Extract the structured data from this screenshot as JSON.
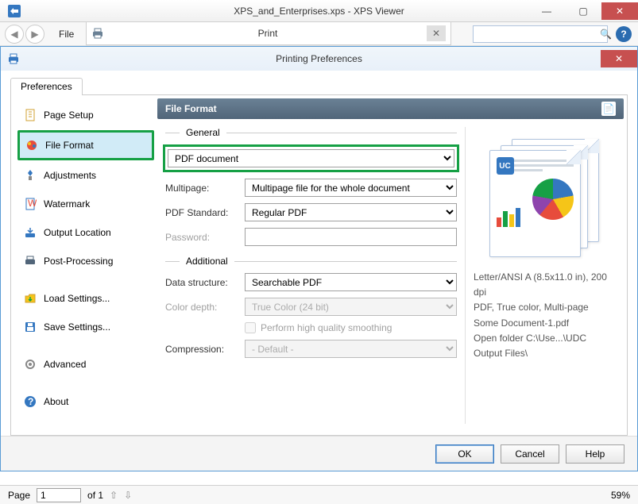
{
  "window": {
    "title": "XPS_and_Enterprises.xps - XPS Viewer",
    "min": "—",
    "max": "▢",
    "close": "✕"
  },
  "toolbar2": {
    "file": "File",
    "print_title": "Print",
    "close_x": "✕",
    "help": "?"
  },
  "dialog": {
    "title": "Printing Preferences",
    "close": "✕",
    "tab": "Preferences",
    "nav": {
      "page_setup": "Page Setup",
      "file_format": "File Format",
      "adjustments": "Adjustments",
      "watermark": "Watermark",
      "output_location": "Output Location",
      "post_processing": "Post-Processing",
      "load_settings": "Load Settings...",
      "save_settings": "Save Settings...",
      "advanced": "Advanced",
      "about": "About"
    },
    "panel_title": "File Format",
    "general_label": "General",
    "additional_label": "Additional",
    "fields": {
      "format_value": "PDF document",
      "multipage_label": "Multipage:",
      "multipage_value": "Multipage file for the whole document",
      "pdf_standard_label": "PDF Standard:",
      "pdf_standard_value": "Regular PDF",
      "password_label": "Password:",
      "password_value": "",
      "data_structure_label": "Data structure:",
      "data_structure_value": "Searchable PDF",
      "color_depth_label": "Color depth:",
      "color_depth_value": "True Color (24 bit)",
      "smoothing_label": "Perform high quality smoothing",
      "compression_label": "Compression:",
      "compression_value": "- Default -"
    },
    "preview": {
      "line1": "Letter/ANSI A (8.5x11.0 in), 200 dpi",
      "line2": "PDF, True color, Multi-page",
      "line3": "Some Document-1.pdf",
      "line4": "Open folder C:\\Use...\\UDC Output Files\\"
    },
    "footer": {
      "ok": "OK",
      "cancel": "Cancel",
      "help": "Help"
    }
  },
  "statusbar": {
    "page_label": "Page",
    "page_value": "1",
    "of": "of 1",
    "zoom": "59%"
  }
}
